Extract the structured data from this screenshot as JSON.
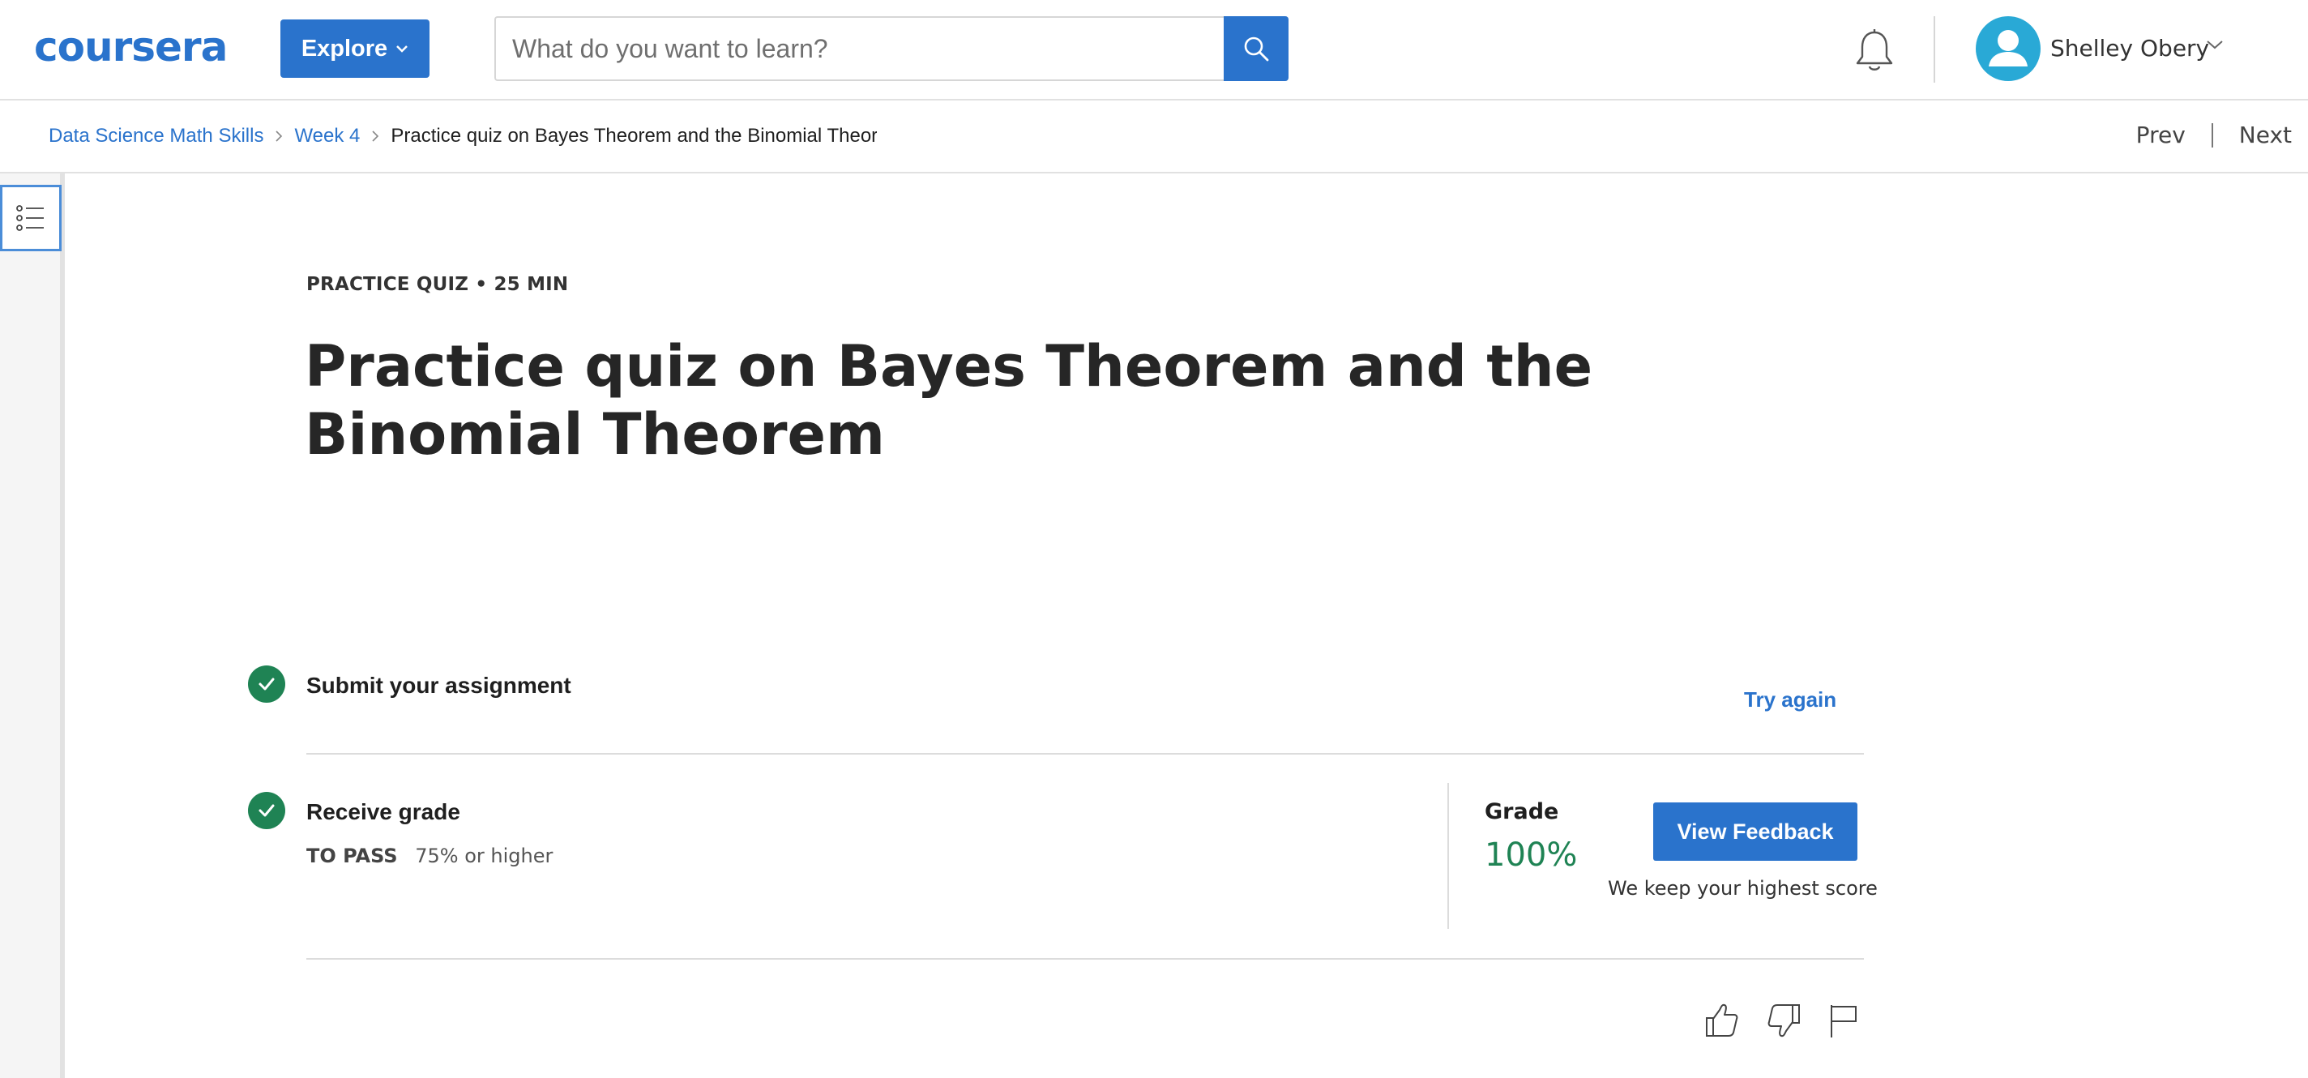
{
  "app": {
    "logo_text": "coursera",
    "brand_color": "#2a73cc",
    "success_color": "#1f8354"
  },
  "header": {
    "explore_label": "Explore",
    "search_placeholder": "What do you want to learn?",
    "search_icon": "search-icon",
    "notification_icon": "bell-icon",
    "user_name": "Shelley Obery",
    "avatar_icon": "user-avatar-icon"
  },
  "breadcrumb": {
    "items": [
      "Data Science Math Skills",
      "Week 4"
    ],
    "current": "Practice quiz on Bayes Theorem and the Binomial Theorem",
    "prev_label": "Prev",
    "next_label": "Next"
  },
  "sidebar": {
    "toggle_icon": "list-icon"
  },
  "quiz": {
    "eyebrow": "PRACTICE QUIZ • 25 MIN",
    "title": "Practice quiz on Bayes Theorem and the Binomial Theorem",
    "submit_step": {
      "title": "Submit your assignment",
      "action_label": "Try again",
      "completed": true
    },
    "grade_step": {
      "title": "Receive grade",
      "pass_label": "TO PASS",
      "pass_value": "75% or higher",
      "completed": true,
      "grade_label": "Grade",
      "grade_value": "100%",
      "feedback_label": "View Feedback",
      "highest_note": "We keep your highest score"
    },
    "rating_icons": [
      "thumbs-up-icon",
      "thumbs-down-icon",
      "flag-icon"
    ]
  }
}
